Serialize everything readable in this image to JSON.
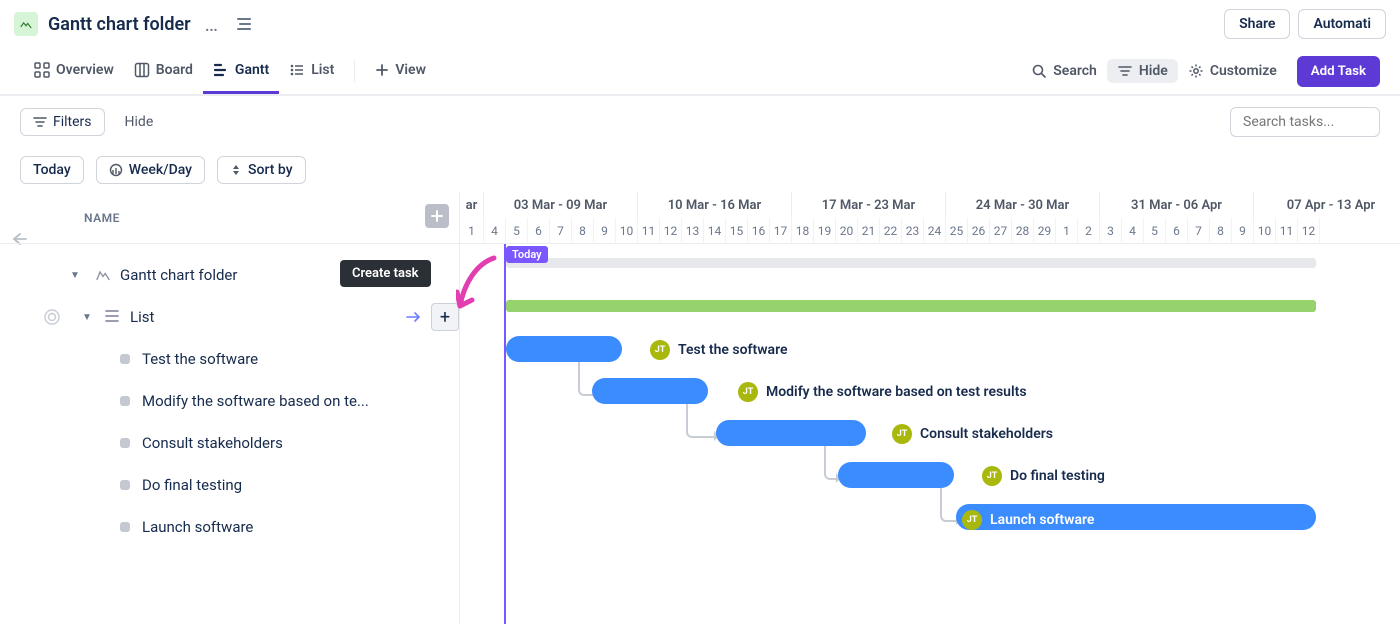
{
  "title": {
    "name": "Gantt chart folder"
  },
  "header_buttons": {
    "share": "Share",
    "automation": "Automati"
  },
  "tabs": {
    "overview": "Overview",
    "board": "Board",
    "gantt": "Gantt",
    "list": "List",
    "addview": "View"
  },
  "tabtools": {
    "search": "Search",
    "hide": "Hide",
    "customize": "Customize",
    "addtask": "Add Task"
  },
  "filters": {
    "filters": "Filters",
    "hide": "Hide"
  },
  "search": {
    "placeholder": "Search tasks..."
  },
  "controls": {
    "today": "Today",
    "scale": "Week/Day",
    "sort": "Sort by"
  },
  "leftcol": {
    "header": "NAME"
  },
  "tooltip": {
    "create_task": "Create task"
  },
  "tree": {
    "folder": "Gantt chart folder",
    "list": "List",
    "tasks": [
      {
        "label": "Test the software"
      },
      {
        "label": "Modify the software based on te..."
      },
      {
        "label": "Consult stakeholders"
      },
      {
        "label": "Do final testing"
      },
      {
        "label": "Launch software"
      }
    ]
  },
  "timeline": {
    "partial_header": "ar",
    "weeks": [
      {
        "label": "03 Mar - 09 Mar"
      },
      {
        "label": "10 Mar - 16 Mar"
      },
      {
        "label": "17 Mar - 23 Mar"
      },
      {
        "label": "24 Mar - 30 Mar"
      },
      {
        "label": "31 Mar - 06 Apr"
      },
      {
        "label": "07 Apr - 13 Apr"
      }
    ],
    "days": [
      "1",
      "4",
      "5",
      "6",
      "7",
      "8",
      "9",
      "10",
      "11",
      "12",
      "13",
      "14",
      "15",
      "16",
      "17",
      "18",
      "19",
      "20",
      "21",
      "22",
      "23",
      "24",
      "25",
      "26",
      "27",
      "28",
      "29",
      "1",
      "2",
      "3",
      "4",
      "5",
      "6",
      "7",
      "8",
      "9",
      "10",
      "11",
      "12"
    ],
    "today_label": "Today",
    "assignee_initials": "JT",
    "bars": {
      "test": {
        "label": "Test the software"
      },
      "modify": {
        "label": "Modify the software based on test results"
      },
      "consult": {
        "label": "Consult stakeholders"
      },
      "final": {
        "label": "Do final testing"
      },
      "launch": {
        "label": "Launch software"
      }
    }
  },
  "colors": {
    "accent": "#5d3ad6",
    "bar": "#3b8cff",
    "green": "#95d36c",
    "avatar": "#a9b80c"
  }
}
